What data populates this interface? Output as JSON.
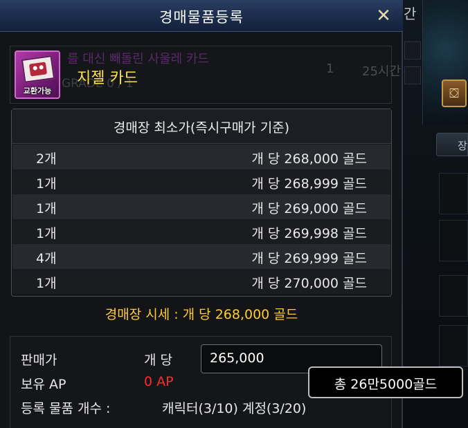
{
  "dialog": {
    "title": "경매물품등록",
    "close_symbol": "✕"
  },
  "background": {
    "edge_text": "간",
    "tab_label": "장",
    "chest_symbol": "⛋"
  },
  "item": {
    "name": "지젤 카드",
    "icon_label": "교환가능",
    "ghost_name": "를 대신 빼돌린 사울레 카드",
    "ghost_grade": "GRADE 0 / 1",
    "ghost_qty": "1",
    "ghost_time": "25시간"
  },
  "price_table": {
    "header": "경매장 최소가(즉시구매가 기준)",
    "rows": [
      {
        "qty": "2개",
        "price": "개 당 268,000 골드"
      },
      {
        "qty": "1개",
        "price": "개 당 268,999 골드"
      },
      {
        "qty": "1개",
        "price": "개 당 269,000 골드"
      },
      {
        "qty": "1개",
        "price": "개 당 269,998 골드"
      },
      {
        "qty": "4개",
        "price": "개 당 269,999 골드"
      },
      {
        "qty": "1개",
        "price": "개 당 270,000 골드"
      }
    ]
  },
  "market_price": "경매장 시세 : 개 당 268,000 골드",
  "form": {
    "sale_price_label": "판매가",
    "per_unit_label": "개 당",
    "price_value": "265,000",
    "ap_label": "보유 AP",
    "ap_value": "0 AP",
    "registered_label": "등록 물품 개수 :",
    "registered_value": "캐릭터(3/10) 계정(3/20)"
  },
  "tooltip": {
    "total": "총 26만5000골드"
  }
}
